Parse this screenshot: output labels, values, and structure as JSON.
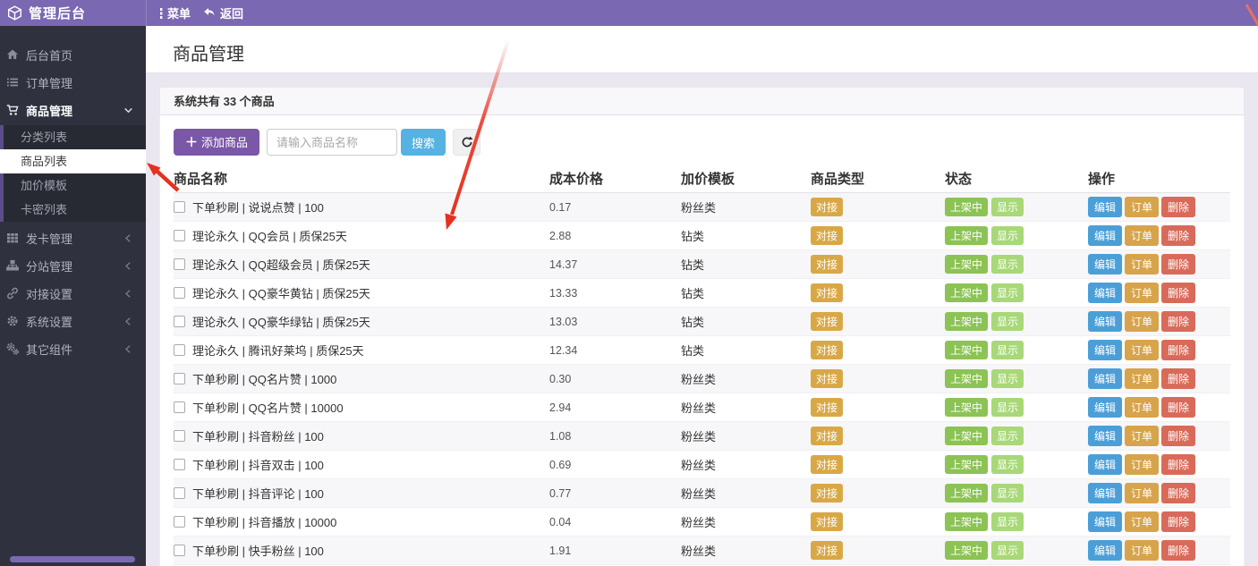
{
  "topbar": {
    "brand": "管理后台",
    "menu_label": "菜单",
    "back_label": "返回"
  },
  "sidebar": {
    "items": [
      {
        "label": "后台首页",
        "icon": "home-icon",
        "type": "link"
      },
      {
        "label": "订单管理",
        "icon": "list-icon",
        "type": "link"
      },
      {
        "label": "商品管理",
        "icon": "cart-icon",
        "type": "group-open",
        "children": [
          "分类列表",
          "商品列表",
          "加价模板",
          "卡密列表"
        ],
        "active_child": "商品列表"
      },
      {
        "label": "发卡管理",
        "icon": "grid-icon",
        "type": "group"
      },
      {
        "label": "分站管理",
        "icon": "sitemap-icon",
        "type": "group"
      },
      {
        "label": "对接设置",
        "icon": "link-icon",
        "type": "group"
      },
      {
        "label": "系统设置",
        "icon": "gear-icon",
        "type": "group"
      },
      {
        "label": "其它组件",
        "icon": "gears-icon",
        "type": "group"
      }
    ]
  },
  "page": {
    "title": "商品管理"
  },
  "panel": {
    "heading": "系统共有 33 个商品",
    "total_count": "33"
  },
  "toolbar": {
    "add_button": "添加商品",
    "search_placeholder": "请输入商品名称",
    "search_button": "搜索",
    "refresh_icon": "refresh-icon"
  },
  "table": {
    "columns": [
      "商品名称",
      "成本价格",
      "加价模板",
      "商品类型",
      "状态",
      "操作"
    ],
    "type_badge": "对接",
    "status_badges": [
      "上架中",
      "显示"
    ],
    "action_buttons": [
      "编辑",
      "订单",
      "删除"
    ],
    "rows": [
      {
        "name": "下单秒刷 | 说说点赞 | 100",
        "price": "0.17",
        "template": "粉丝类",
        "type": "对接",
        "status": [
          "上架中",
          "显示"
        ],
        "actions": [
          "编辑",
          "订单",
          "删除"
        ]
      },
      {
        "name": "理论永久 | QQ会员 | 质保25天",
        "price": "2.88",
        "template": "钻类",
        "type": "对接",
        "status": [
          "上架中",
          "显示"
        ],
        "actions": [
          "编辑",
          "订单",
          "删除"
        ]
      },
      {
        "name": "理论永久 | QQ超级会员 | 质保25天",
        "price": "14.37",
        "template": "钻类",
        "type": "对接",
        "status": [
          "上架中",
          "显示"
        ],
        "actions": [
          "编辑",
          "订单",
          "删除"
        ]
      },
      {
        "name": "理论永久 | QQ豪华黄钻 | 质保25天",
        "price": "13.33",
        "template": "钻类",
        "type": "对接",
        "status": [
          "上架中",
          "显示"
        ],
        "actions": [
          "编辑",
          "订单",
          "删除"
        ]
      },
      {
        "name": "理论永久 | QQ豪华绿钻 | 质保25天",
        "price": "13.03",
        "template": "钻类",
        "type": "对接",
        "status": [
          "上架中",
          "显示"
        ],
        "actions": [
          "编辑",
          "订单",
          "删除"
        ]
      },
      {
        "name": "理论永久 | 腾讯好莱坞 | 质保25天",
        "price": "12.34",
        "template": "钻类",
        "type": "对接",
        "status": [
          "上架中",
          "显示"
        ],
        "actions": [
          "编辑",
          "订单",
          "删除"
        ]
      },
      {
        "name": "下单秒刷 | QQ名片赞 | 1000",
        "price": "0.30",
        "template": "粉丝类",
        "type": "对接",
        "status": [
          "上架中",
          "显示"
        ],
        "actions": [
          "编辑",
          "订单",
          "删除"
        ]
      },
      {
        "name": "下单秒刷 | QQ名片赞 | 10000",
        "price": "2.94",
        "template": "粉丝类",
        "type": "对接",
        "status": [
          "上架中",
          "显示"
        ],
        "actions": [
          "编辑",
          "订单",
          "删除"
        ]
      },
      {
        "name": "下单秒刷 | 抖音粉丝 | 100",
        "price": "1.08",
        "template": "粉丝类",
        "type": "对接",
        "status": [
          "上架中",
          "显示"
        ],
        "actions": [
          "编辑",
          "订单",
          "删除"
        ]
      },
      {
        "name": "下单秒刷 | 抖音双击 | 100",
        "price": "0.69",
        "template": "粉丝类",
        "type": "对接",
        "status": [
          "上架中",
          "显示"
        ],
        "actions": [
          "编辑",
          "订单",
          "删除"
        ]
      },
      {
        "name": "下单秒刷 | 抖音评论 | 100",
        "price": "0.77",
        "template": "粉丝类",
        "type": "对接",
        "status": [
          "上架中",
          "显示"
        ],
        "actions": [
          "编辑",
          "订单",
          "删除"
        ]
      },
      {
        "name": "下单秒刷 | 抖音播放 | 10000",
        "price": "0.04",
        "template": "粉丝类",
        "type": "对接",
        "status": [
          "上架中",
          "显示"
        ],
        "actions": [
          "编辑",
          "订单",
          "删除"
        ]
      },
      {
        "name": "下单秒刷 | 快手粉丝 | 100",
        "price": "1.91",
        "template": "粉丝类",
        "type": "对接",
        "status": [
          "上架中",
          "显示"
        ],
        "actions": [
          "编辑",
          "订单",
          "删除"
        ]
      }
    ]
  },
  "colors": {
    "topbar": "#7a68b2",
    "sidebar": "#2f323e",
    "submenu": "#272a33",
    "submenu_border": "#5b4d8c",
    "page_bg": "#eae7f0",
    "add_button": "#7b57a8",
    "search_button": "#56b2e1",
    "type_badge": "#d9a846",
    "status_on": "#8cc355",
    "status_show": "#a8d878",
    "edit_button": "#4b9fd8",
    "order_button": "#d7a44b",
    "delete_button": "#d96a5a",
    "annotation_arrow": "#e7301f"
  }
}
